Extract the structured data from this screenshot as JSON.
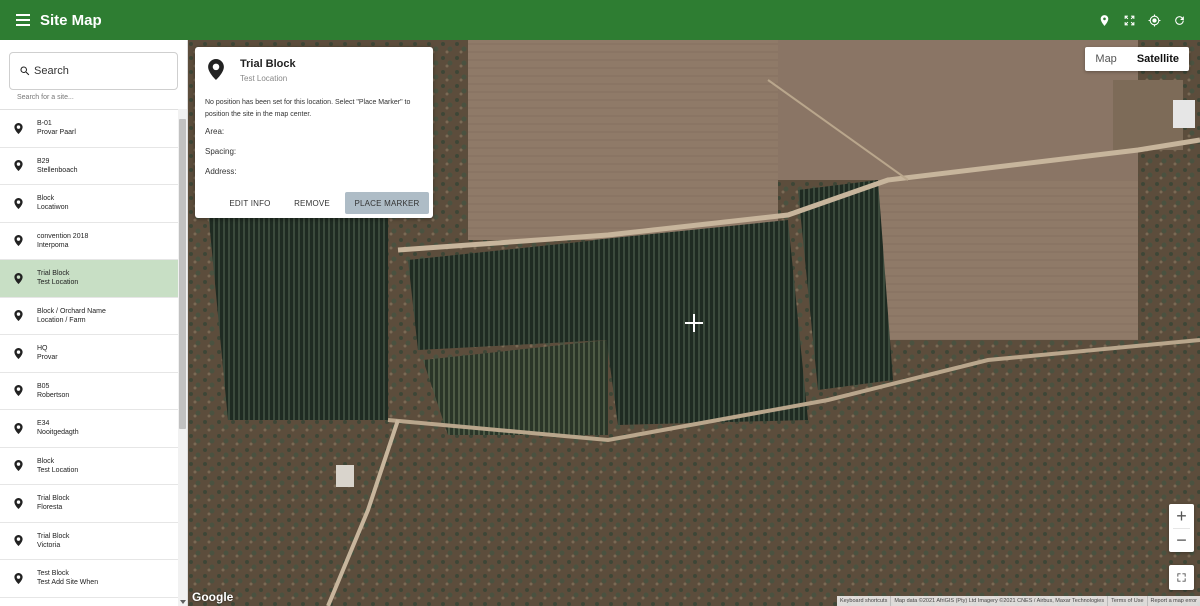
{
  "appbar": {
    "title": "Site Map",
    "actions": [
      "location-pin-icon",
      "fit-bounds-icon",
      "my-location-icon",
      "refresh-icon"
    ],
    "color": "#2e7d32"
  },
  "sidebar": {
    "search_label": "Search",
    "search_hint": "Search for a site...",
    "selected_color": "#c8dfc5",
    "items": [
      {
        "name": "B-01",
        "location": "Provar Paarl",
        "active": false
      },
      {
        "name": "B29",
        "location": "Stellenboach",
        "active": false
      },
      {
        "name": "Block",
        "location": "Locatiwon",
        "active": false
      },
      {
        "name": "convention 2018",
        "location": "Interpoma",
        "active": false
      },
      {
        "name": "Trial Block",
        "location": "Test Location",
        "active": true
      },
      {
        "name": "Block / Orchard Name",
        "location": "Location / Farm",
        "active": false
      },
      {
        "name": "HQ",
        "location": "Provar",
        "active": false
      },
      {
        "name": "B05",
        "location": "Robertson",
        "active": false
      },
      {
        "name": "E34",
        "location": "Nooitgedagth",
        "active": false
      },
      {
        "name": "Block",
        "location": "Test Location",
        "active": false
      },
      {
        "name": "Trial Block",
        "location": "Floresta",
        "active": false
      },
      {
        "name": "Trial Block",
        "location": "Victoria",
        "active": false
      },
      {
        "name": "Test Block",
        "location": "Test Add Site When",
        "active": false
      }
    ]
  },
  "info_card": {
    "title": "Trial Block",
    "subtitle": "Test Location",
    "message": "No position has been set for this location. Select \"Place Marker\" to position the site in the map center.",
    "area_label": "Area:",
    "spacing_label": "Spacing:",
    "address_label": "Address:",
    "edit_label": "EDIT INFO",
    "remove_label": "REMOVE",
    "place_label": "PLACE MARKER"
  },
  "map": {
    "type_map": "Map",
    "type_satellite": "Satellite",
    "active_type": "Satellite",
    "zoom_in": "+",
    "zoom_out": "−",
    "google": "Google",
    "attribution": [
      "Keyboard shortcuts",
      "Map data ©2021 AfriGIS (Pty) Ltd Imagery ©2021 CNES / Airbus, Maxar Technologies",
      "Terms of Use",
      "Report a map error"
    ]
  }
}
